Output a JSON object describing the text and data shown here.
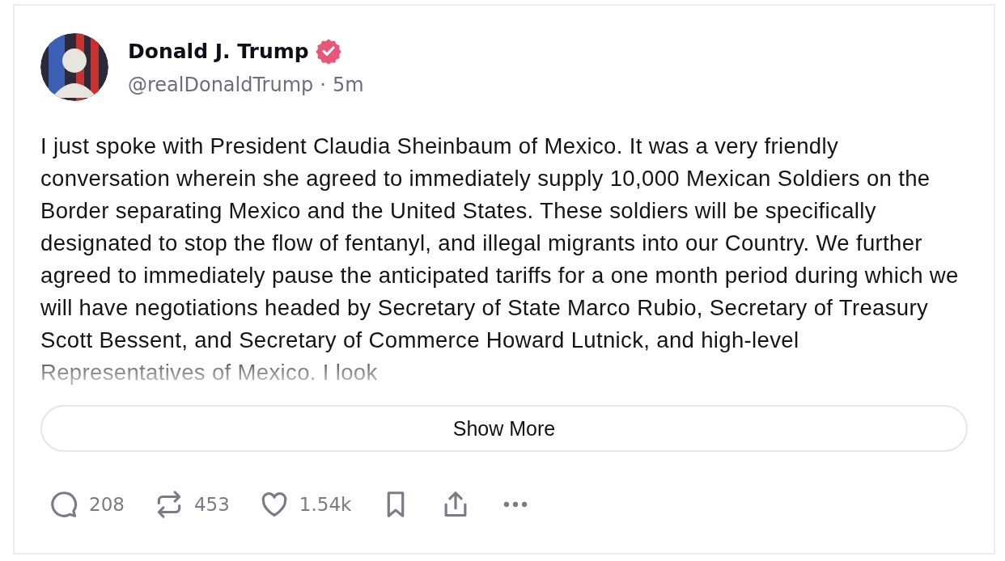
{
  "post": {
    "author": {
      "name": "Donald J. Trump",
      "verified": true,
      "handle": "@realDonaldTrump",
      "separator": "·",
      "time": "5m"
    },
    "text": "I just spoke with President Claudia Sheinbaum of Mexico. It was a very friendly conversation wherein she agreed to immediately supply 10,000 Mexican Soldiers on the Border separating Mexico and the United States. These soldiers will be specifically designated to stop the flow of fentanyl, and illegal migrants into our Country. We further agreed to immediately pause the anticipated tariffs for a one month period during which we will have negotiations headed by Secretary of State Marco Rubio, Secretary of Treasury Scott Bessent, and Secretary of Commerce Howard Lutnick, and high-level Representatives of Mexico. I look",
    "show_more": "Show More",
    "actions": [
      {
        "kind": "reply",
        "count": "208"
      },
      {
        "kind": "repost",
        "count": "453"
      },
      {
        "kind": "like",
        "count": "1.54k"
      },
      {
        "kind": "bookmark"
      },
      {
        "kind": "share"
      },
      {
        "kind": "more"
      }
    ]
  }
}
